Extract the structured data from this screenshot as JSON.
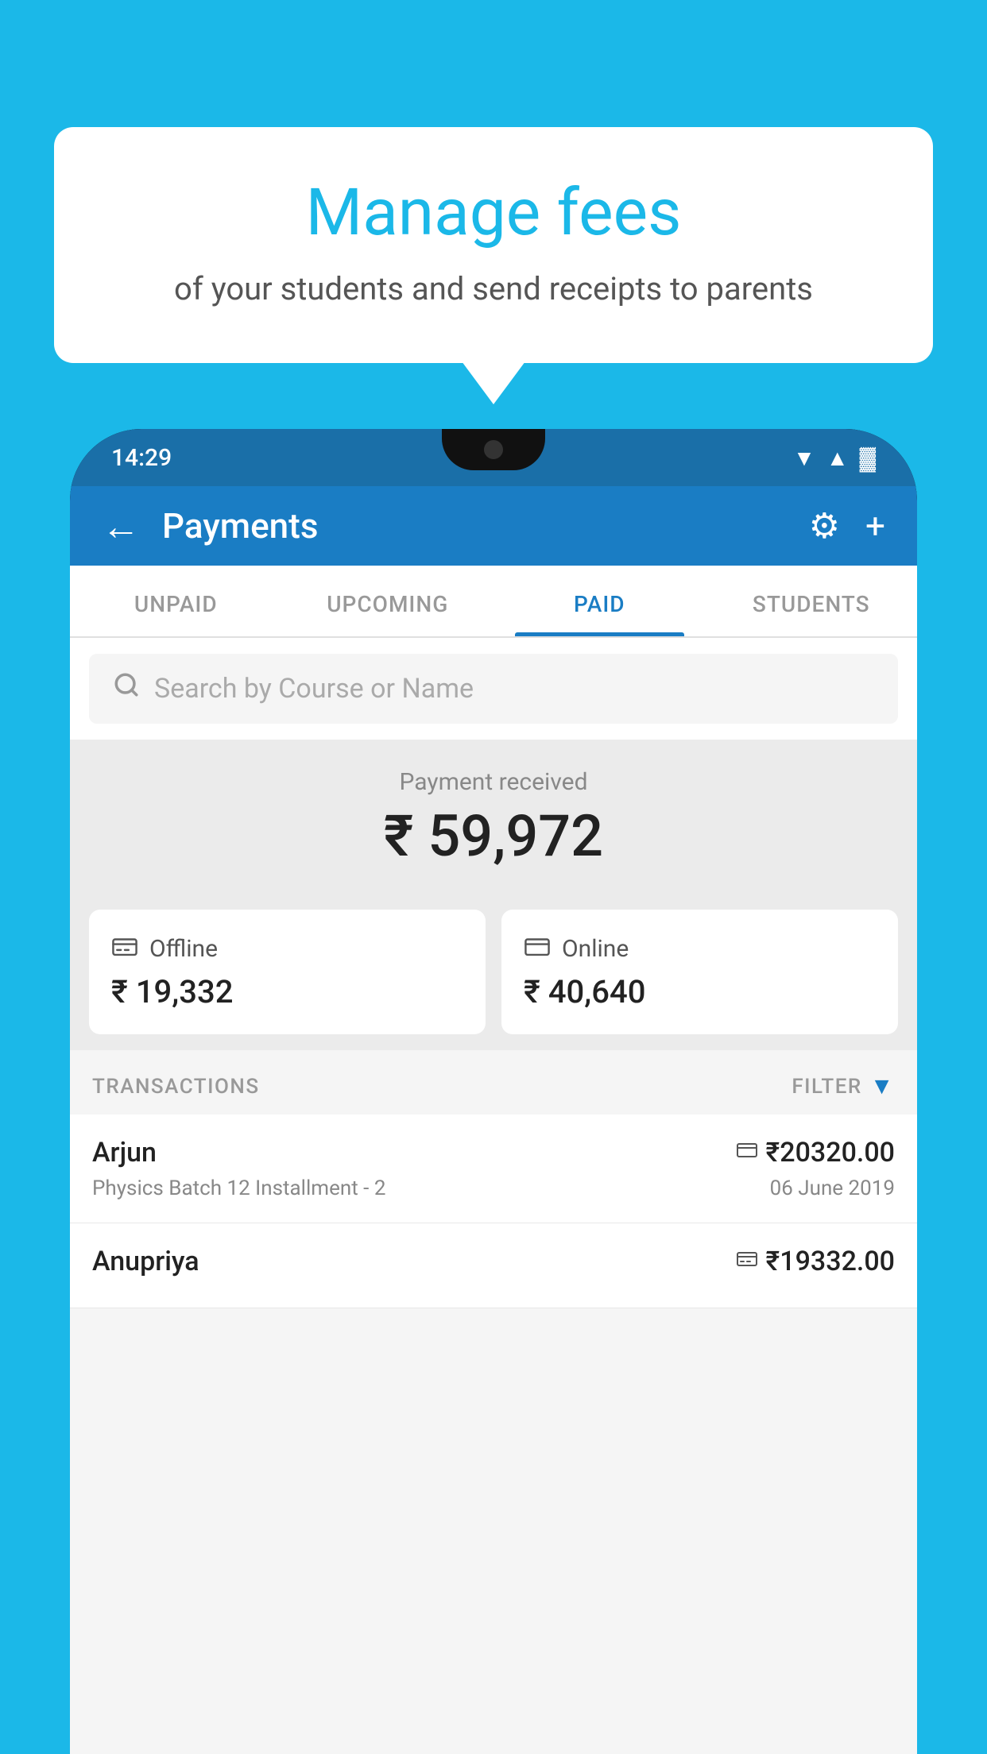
{
  "background_color": "#1bb8e8",
  "bubble": {
    "title": "Manage fees",
    "subtitle": "of your students and send receipts to parents"
  },
  "status_bar": {
    "time": "14:29",
    "wifi_icon": "▼",
    "signal_icon": "▲",
    "battery_icon": "▓"
  },
  "app_bar": {
    "back_label": "←",
    "title": "Payments",
    "gear_icon": "⚙",
    "plus_icon": "+"
  },
  "tabs": [
    {
      "label": "UNPAID",
      "active": false
    },
    {
      "label": "UPCOMING",
      "active": false
    },
    {
      "label": "PAID",
      "active": true
    },
    {
      "label": "STUDENTS",
      "active": false
    }
  ],
  "search": {
    "placeholder": "Search by Course or Name"
  },
  "payment_received": {
    "label": "Payment received",
    "amount": "₹ 59,972"
  },
  "payment_cards": {
    "offline": {
      "label": "Offline",
      "amount": "₹ 19,332"
    },
    "online": {
      "label": "Online",
      "amount": "₹ 40,640"
    }
  },
  "transactions_header": {
    "label": "TRANSACTIONS",
    "filter_label": "FILTER"
  },
  "transactions": [
    {
      "name": "Arjun",
      "course": "Physics Batch 12 Installment - 2",
      "amount": "₹20320.00",
      "date": "06 June 2019",
      "payment_type": "online"
    },
    {
      "name": "Anupriya",
      "course": "",
      "amount": "₹19332.00",
      "date": "",
      "payment_type": "offline"
    }
  ]
}
